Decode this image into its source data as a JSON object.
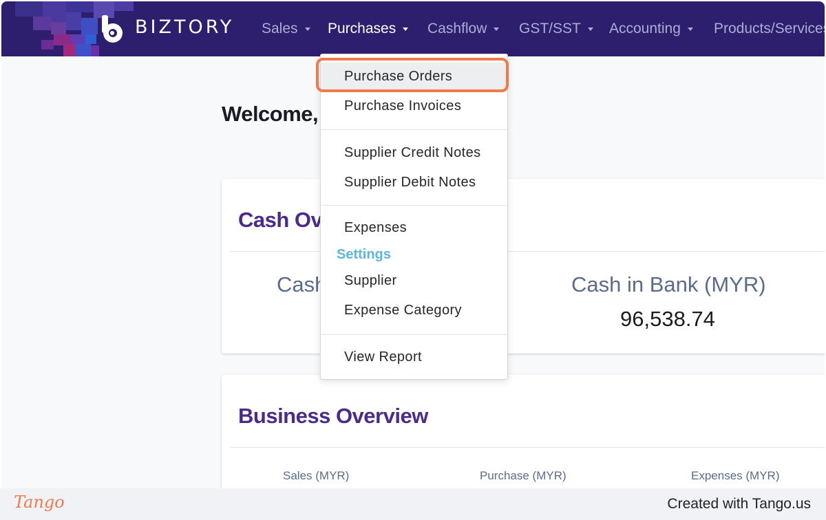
{
  "app": {
    "logo_text": "BIZTORY"
  },
  "nav": {
    "items": [
      {
        "label": "Sales"
      },
      {
        "label": "Purchases"
      },
      {
        "label": "Cashflow"
      },
      {
        "label": "GST/SST"
      },
      {
        "label": "Accounting"
      },
      {
        "label": "Products/Services"
      }
    ]
  },
  "main": {
    "welcome": "Welcome,",
    "cash_card": {
      "title": "Cash Ov",
      "cash_label": "Cash",
      "bank_label": "Cash in Bank (MYR)",
      "bank_value": "96,538.74"
    },
    "business_card": {
      "title": "Business Overview",
      "columns": [
        "Sales (MYR)",
        "Purchase (MYR)",
        "Expenses (MYR)"
      ]
    }
  },
  "dropdown": {
    "items": {
      "purchase_orders": "Purchase Orders",
      "purchase_invoices": "Purchase Invoices",
      "supplier_credit_notes": "Supplier Credit Notes",
      "supplier_debit_notes": "Supplier Debit Notes",
      "expenses": "Expenses",
      "settings_header": "Settings",
      "supplier": "Supplier",
      "expense_category": "Expense Category",
      "view_report": "View Report"
    }
  },
  "footer": {
    "tango_logo": "Tango",
    "created_with": "Created with Tango.us"
  },
  "colors": {
    "navbar": "#2d1f6e",
    "accent_highlight": "#f07a4a",
    "card_title": "#4a2a8c",
    "settings_header": "#5bb7e0"
  }
}
